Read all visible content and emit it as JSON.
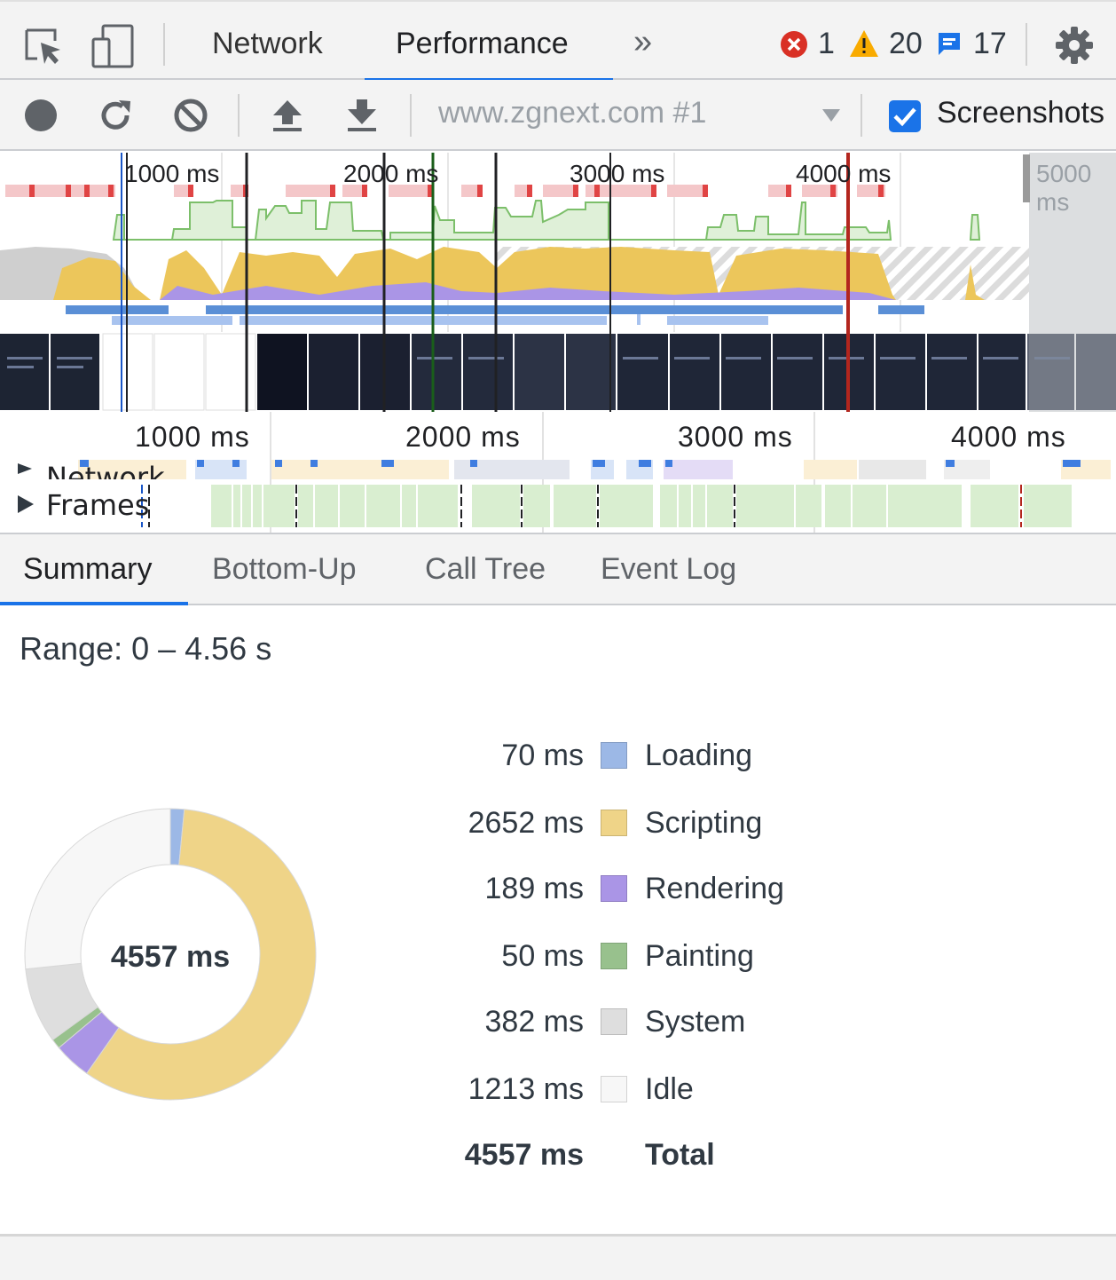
{
  "tabs": {
    "network": "Network",
    "performance": "Performance",
    "more": "»"
  },
  "status": {
    "errors": "1",
    "warnings": "20",
    "messages": "17"
  },
  "toolbar": {
    "profile_select": "www.zgnext.com #1",
    "screenshots_label": "Screenshots",
    "screenshots_checked": true
  },
  "overview": {
    "ticks": [
      "1000 ms",
      "2000 ms",
      "3000 ms",
      "4000 ms",
      "5000 ms"
    ]
  },
  "timeline": {
    "ticks": [
      "1000 ms",
      "2000 ms",
      "3000 ms",
      "4000 ms"
    ],
    "tracks": {
      "network": "Network",
      "frames": "Frames"
    }
  },
  "detail_tabs": [
    "Summary",
    "Bottom-Up",
    "Call Tree",
    "Event Log"
  ],
  "summary": {
    "range": "Range: 0 – 4.56 s",
    "center_label": "4557 ms",
    "rows": [
      {
        "value": "70 ms",
        "label": "Loading",
        "color": "#9cb8e6",
        "ms": 70
      },
      {
        "value": "2652 ms",
        "label": "Scripting",
        "color": "#efd488",
        "ms": 2652
      },
      {
        "value": "189 ms",
        "label": "Rendering",
        "color": "#aa95e6",
        "ms": 189
      },
      {
        "value": "50 ms",
        "label": "Painting",
        "color": "#98c18d",
        "ms": 50
      },
      {
        "value": "382 ms",
        "label": "System",
        "color": "#dedede",
        "ms": 382
      },
      {
        "value": "1213 ms",
        "label": "Idle",
        "color": "#f7f7f7",
        "ms": 1213
      }
    ],
    "total_value": "4557 ms",
    "total_label": "Total"
  },
  "colors": {
    "accent": "#1a73e8",
    "error": "#d93025",
    "warning": "#f9ab00"
  }
}
